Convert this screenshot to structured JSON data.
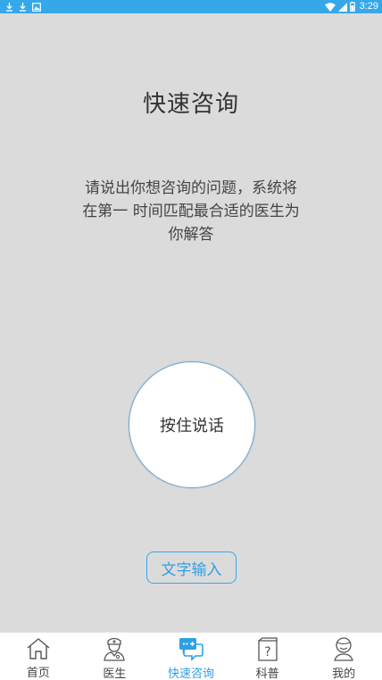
{
  "status_bar": {
    "time": "3:29",
    "left_icons": [
      "download-icon",
      "download-icon",
      "image-icon"
    ],
    "right_icons": [
      "wifi-icon",
      "signal-icon",
      "battery-icon"
    ]
  },
  "main": {
    "title": "快速咨询",
    "instructions_line1": "请说出你想咨询的问题，系统将",
    "instructions_line2": "在第一 时间匹配最合适的医生为",
    "instructions_line3": "你解答",
    "voice_button_label": "按住说话",
    "text_input_button_label": "文字输入"
  },
  "bottom_nav": {
    "items": [
      {
        "label": "首页",
        "icon": "home-icon",
        "active": false
      },
      {
        "label": "医生",
        "icon": "doctor-icon",
        "active": false
      },
      {
        "label": "快速咨询",
        "icon": "chat-icon",
        "active": true
      },
      {
        "label": "科普",
        "icon": "question-icon",
        "active": false
      },
      {
        "label": "我的",
        "icon": "user-icon",
        "active": false
      }
    ]
  },
  "colors": {
    "accent": "#35a8ea",
    "background": "#dcdbdc",
    "nav_active": "#2e9fe6"
  }
}
